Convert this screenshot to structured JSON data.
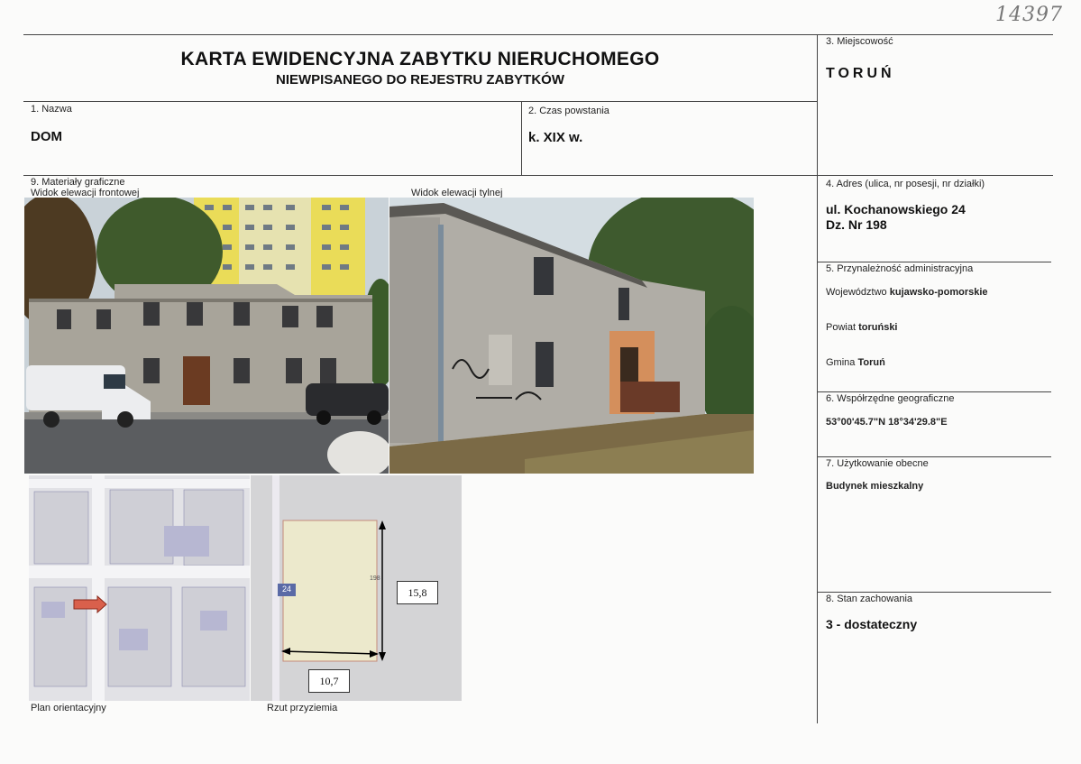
{
  "archive_number": "14397",
  "header": {
    "title": "KARTA EWIDENCYJNA ZABYTKU NIERUCHOMEGO",
    "subtitle": "NIEWPISANEGO DO REJESTRU ZABYTKÓW"
  },
  "fields": {
    "nazwa": {
      "label": "1. Nazwa",
      "value": "DOM"
    },
    "czas": {
      "label": "2. Czas powstania",
      "value": "k. XIX w."
    },
    "miejscowosc": {
      "label": "3. Miejscowość",
      "value": "TORUŃ"
    },
    "adres": {
      "label": "4. Adres (ulica, nr posesji, nr działki)",
      "line1": "ul. Kochanowskiego 24",
      "line2": "Dz. Nr 198"
    },
    "przynaleznosc": {
      "label": "5. Przynależność administracyjna",
      "woj_prefix": "Województwo",
      "woj_value": "kujawsko-pomorskie",
      "powiat_prefix": "Powiat",
      "powiat_value": "toruński",
      "gmina_prefix": "Gmina",
      "gmina_value": "Toruń"
    },
    "wspolrzedne": {
      "label": "6. Współrzędne geograficzne",
      "value": "53°00'45.7\"N 18°34'29.8\"E"
    },
    "uzytkowanie": {
      "label": "7. Użytkowanie obecne",
      "value": "Budynek mieszkalny"
    },
    "stan": {
      "label": "8. Stan zachowania",
      "value": "3 - dostateczny"
    }
  },
  "graphics": {
    "label": "9. Materiały graficzne",
    "front_caption": "Widok elewacji frontowej",
    "rear_caption": "Widok elewacji tylnej",
    "plan_caption": "Plan orientacyjny",
    "rzut_caption": "Rzut przyziemia",
    "dim_height": "15,8",
    "dim_width": "10,7",
    "parcel_number": "198",
    "house_number": "24"
  }
}
